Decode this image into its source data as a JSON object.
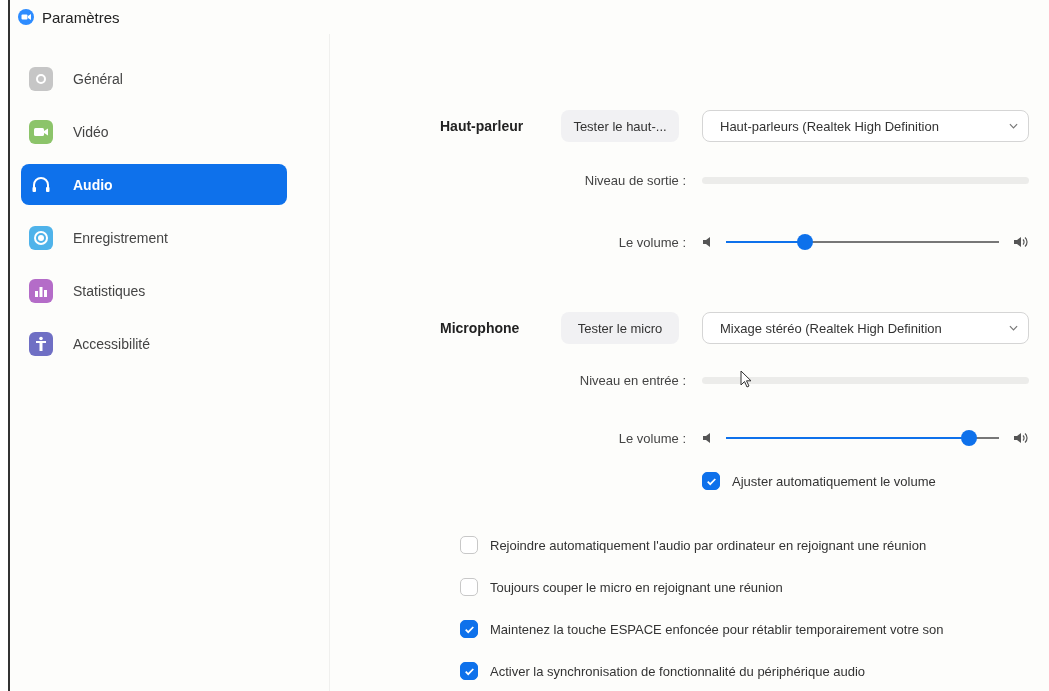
{
  "window": {
    "title": "Paramètres"
  },
  "sidebar": {
    "items": [
      {
        "label": "Général",
        "selected": false,
        "color": "#c6c6c6"
      },
      {
        "label": "Vidéo",
        "selected": false,
        "color": "#8cc46a"
      },
      {
        "label": "Audio",
        "selected": true,
        "color": "#0e71eb"
      },
      {
        "label": "Enregistrement",
        "selected": false,
        "color": "#4fb3ea"
      },
      {
        "label": "Statistiques",
        "selected": false,
        "color": "#b46cc8"
      },
      {
        "label": "Accessibilité",
        "selected": false,
        "color": "#6f6fc4"
      }
    ]
  },
  "speaker": {
    "heading": "Haut-parleur",
    "test_button": "Tester le haut-...",
    "device": "Haut-parleurs (Realtek High Definition",
    "level_label": "Niveau de sortie :",
    "volume_label": "Le volume :",
    "volume": {
      "level": 0.29
    }
  },
  "microphone": {
    "heading": "Microphone",
    "test_button": "Tester le micro",
    "device": "Mixage stéréo (Realtek High Definition",
    "level_label": "Niveau en entrée :",
    "volume_label": "Le volume :",
    "volume": {
      "level": 0.89
    },
    "auto_adjust": {
      "label": "Ajuster automatiquement le volume",
      "checked": true
    }
  },
  "options": [
    {
      "label": "Rejoindre automatiquement l'audio par ordinateur en rejoignant une réunion",
      "checked": false
    },
    {
      "label": "Toujours couper le micro en rejoignant une réunion",
      "checked": false
    },
    {
      "label": "Maintenez la touche ESPACE enfoncée pour rétablir temporairement votre son",
      "checked": true
    },
    {
      "label": "Activer la synchronisation de fonctionnalité du périphérique audio",
      "checked": true
    }
  ]
}
